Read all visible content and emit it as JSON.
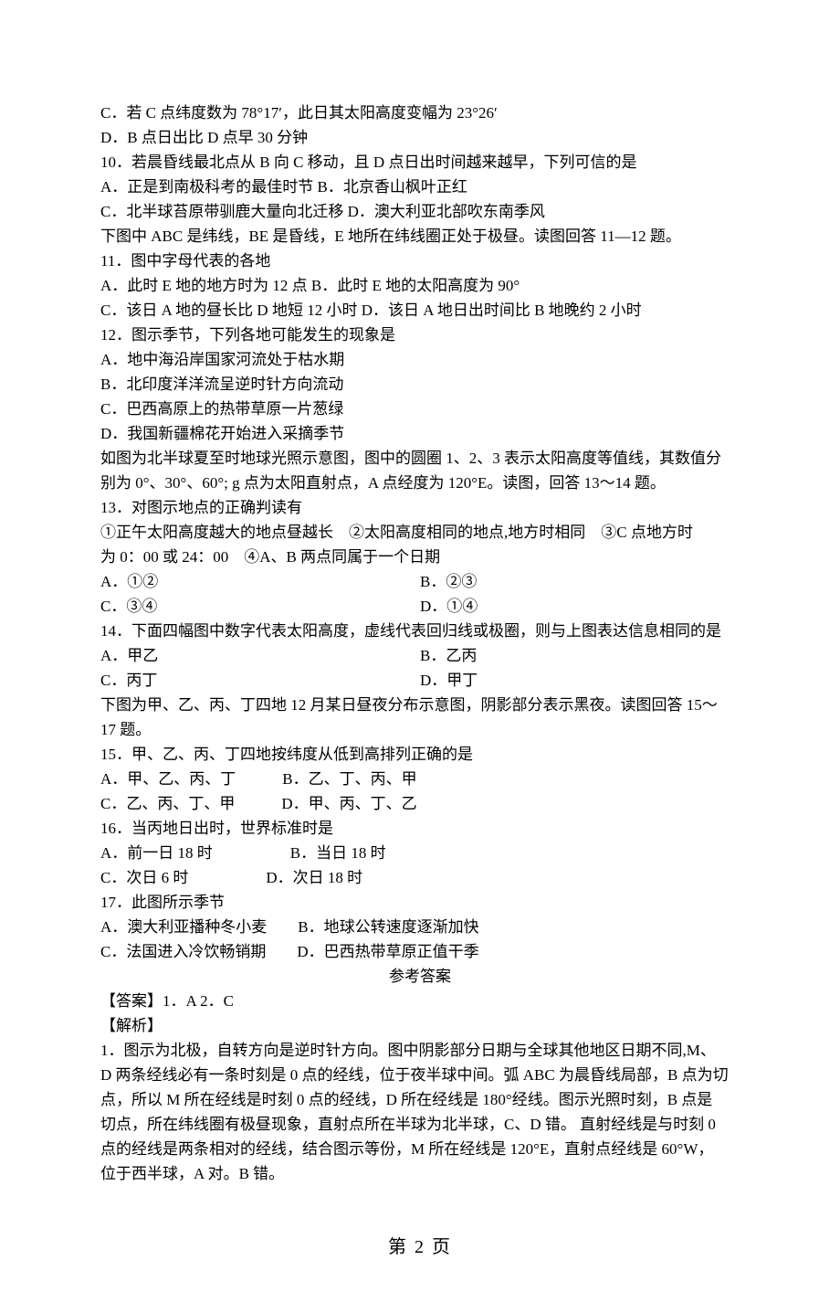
{
  "q9": {
    "c": "C．若 C 点纬度数为 78°17′，此日其太阳高度变幅为 23°26′",
    "d": "D．B 点日出比 D 点早 30 分钟"
  },
  "q10": {
    "stem": "10．若晨昏线最北点从 B 向 C 移动，且 D 点日出时间越来越早，下列可信的是",
    "a": "A．正是到南极科考的最佳时节 B．北京香山枫叶正红",
    "c": "C．北半球苔原带驯鹿大量向北迁移 D．澳大利亚北部吹东南季风"
  },
  "intro11": "下图中 ABC 是纬线，BE 是昏线，E 地所在纬线圈正处于极昼。读图回答 11—12 题。",
  "q11": {
    "stem": "11．图中字母代表的各地",
    "a": "A．此时 E 地的地方时为 12 点 B．此时 E 地的太阳高度为 90°",
    "c": "C．该日 A 地的昼长比 D 地短 12 小时 D．该日 A 地日出时间比 B 地晚约 2 小时"
  },
  "q12": {
    "stem": "12．图示季节，下列各地可能发生的现象是",
    "a": "A．地中海沿岸国家河流处于枯水期",
    "b": "B．北印度洋洋流呈逆时针方向流动",
    "c": "C．巴西高原上的热带草原一片葱绿",
    "d": "D．我国新疆棉花开始进入采摘季节"
  },
  "intro13a": "如图为北半球夏至时地球光照示意图，图中的圆圈 1、2、3 表示太阳高度等值线，其数值分",
  "intro13b": "别为 0°、30°、60°; g 点为太阳直射点，A 点经度为 120°E。读图，回答 13～14 题。",
  "q13": {
    "stem": "13．对图示地点的正确判读有",
    "s1": "①正午太阳高度越大的地点昼越长　②太阳高度相同的地点,地方时相同　③C 点地方时",
    "s2": "为 0：00 或 24：00　④A、B 两点同属于一个日期",
    "opt_a": "A．①②",
    "opt_b": "B．②③",
    "opt_c": "C．③④",
    "opt_d": "D．①④"
  },
  "q14": {
    "stem": "14．下面四幅图中数字代表太阳高度，虚线代表回归线或极圈，则与上图表达信息相同的是",
    "opt_a": "A．甲乙",
    "opt_b": "B．乙丙",
    "opt_c": "C．丙丁",
    "opt_d": "D．甲丁"
  },
  "intro15a": "下图为甲、乙、丙、丁四地 12 月某日昼夜分布示意图，阴影部分表示黑夜。读图回答 15～",
  "intro15b": "17 题。",
  "q15": {
    "stem": "15．甲、乙、丙、丁四地按纬度从低到高排列正确的是",
    "a": "A．甲、乙、丙、丁　　　B．乙、丁、丙、甲",
    "c": "C．乙、丙、丁、甲　　　D．甲、丙、丁、乙"
  },
  "q16": {
    "stem": "16．当丙地日出时，世界标准时是",
    "a": "A．前一日 18 时　　　　　B．当日 18 时",
    "c": "C．次日 6 时　　　　　D．次日 18 时"
  },
  "q17": {
    "stem": "17．此图所示季节",
    "a": "A．澳大利亚播种冬小麦　　B．地球公转速度逐渐加快",
    "c": "C．法国进入冷饮畅销期　　D．巴西热带草原正值干季"
  },
  "answer_title": "参考答案",
  "ans1": "【答案】1．A 2．C",
  "ans2": "【解析】",
  "exp1": "1．图示为北极，自转方向是逆时针方向。图中阴影部分日期与全球其他地区日期不同,M、",
  "exp2": "D 两条经线必有一条时刻是 0 点的经线，位于夜半球中间。弧 ABC 为晨昏线局部，B 点为切",
  "exp3": "点，所以 M 所在经线是时刻 0 点的经线，D 所在经线是 180°经线。图示光照时刻，B 点是",
  "exp4": "切点，所在纬线圈有极昼现象，直射点所在半球为北半球，C、D 错。 直射经线是与时刻 0",
  "exp5": "点的经线是两条相对的经线，结合图示等份，M 所在经线是 120°E，直射点经线是 60°W，",
  "exp6": "位于西半球，A 对。B 错。",
  "page_number": "第 2 页"
}
